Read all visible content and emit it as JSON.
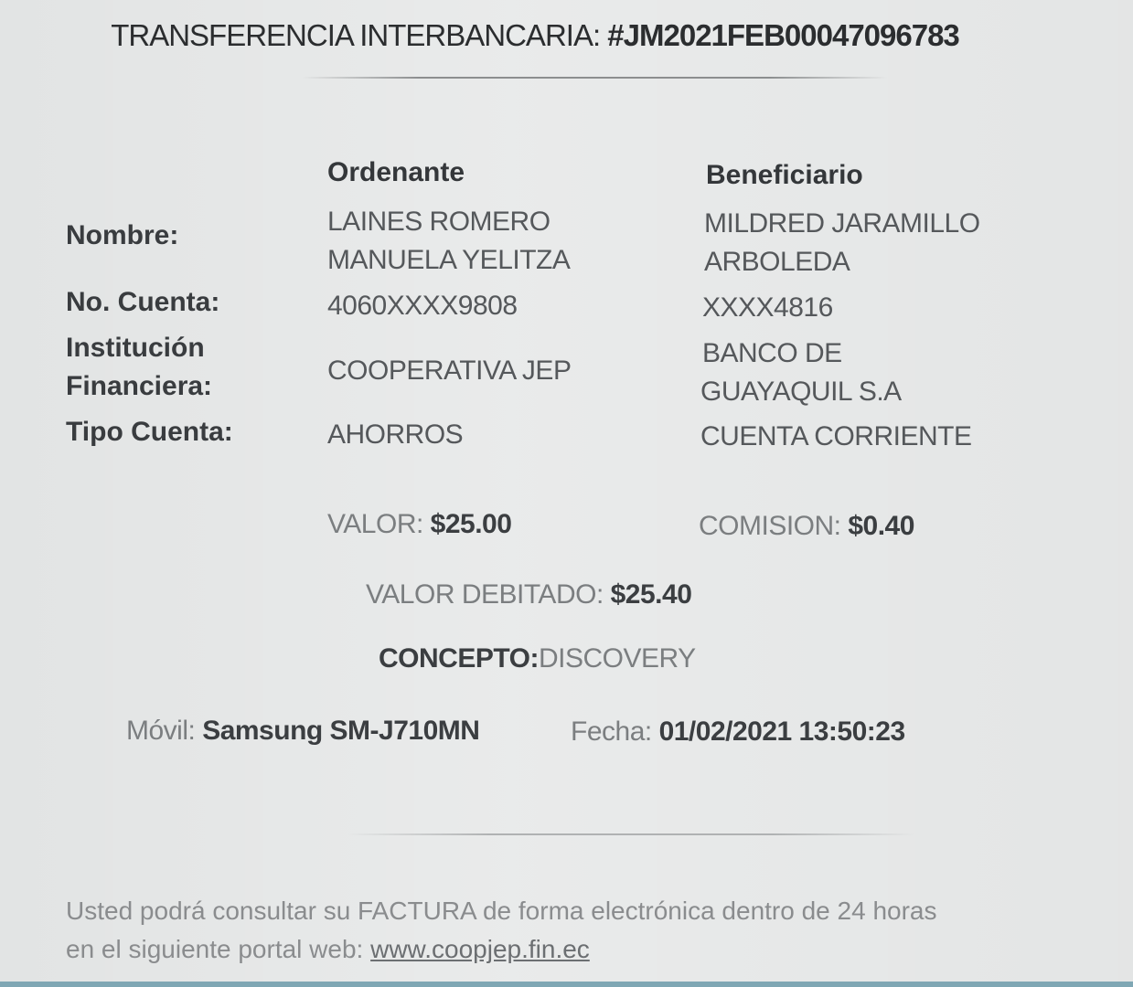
{
  "title": {
    "prefix": "TRANSFERENCIA INTERBANCARIA: ",
    "code": "#JM2021FEB00047096783"
  },
  "columns": {
    "ordenante": "Ordenante",
    "beneficiario": "Beneficiario"
  },
  "labels": {
    "nombre": "Nombre:",
    "cuenta": "No. Cuenta:",
    "institucion_1": "Institución",
    "institucion_2": "Financiera:",
    "tipo": "Tipo Cuenta:"
  },
  "ordenante": {
    "nombre_1": "LAINES ROMERO",
    "nombre_2": "MANUELA YELITZA",
    "cuenta": "4060XXXX9808",
    "institucion": "COOPERATIVA JEP",
    "tipo": "AHORROS"
  },
  "beneficiario": {
    "nombre_1": "MILDRED JARAMILLO",
    "nombre_2": "ARBOLEDA",
    "cuenta": "XXXX4816",
    "institucion_1": "BANCO DE",
    "institucion_2": "GUAYAQUIL S.A",
    "tipo": "CUENTA CORRIENTE"
  },
  "amounts": {
    "valor_label": "VALOR: ",
    "valor": "$25.00",
    "comision_label": "COMISION: ",
    "comision": "$0.40",
    "debitado_label": "VALOR DEBITADO: ",
    "debitado": "$25.40",
    "concepto_label": "CONCEPTO:",
    "concepto": "DISCOVERY"
  },
  "meta": {
    "movil_label": "Móvil: ",
    "movil": "Samsung SM-J710MN",
    "fecha_label": "Fecha: ",
    "fecha": "01/02/2021 13:50:23"
  },
  "footer": {
    "text": "Usted podrá consultar su FACTURA de forma electrónica dentro de 24 horas en el siguiente portal web: ",
    "link": "www.coopjep.fin.ec"
  }
}
